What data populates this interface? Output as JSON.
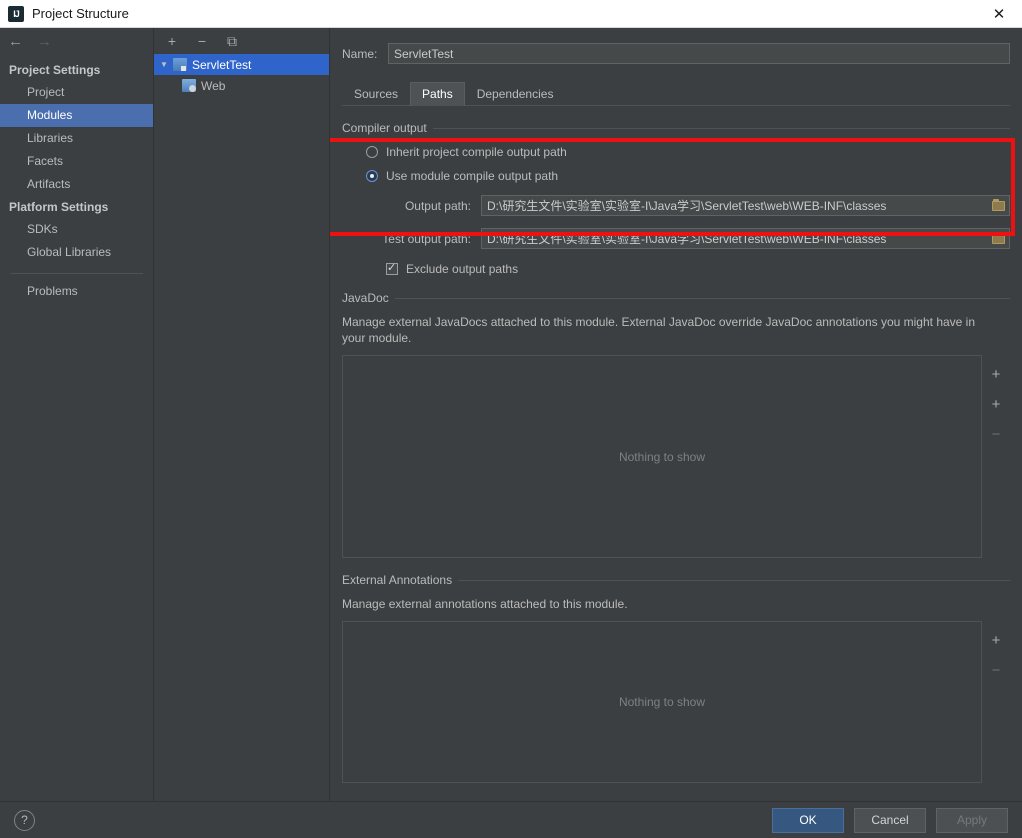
{
  "window": {
    "title": "Project Structure",
    "app_icon": "intellij-idea-icon",
    "close_label": "✕"
  },
  "nav": {
    "back": "←",
    "forward": "→"
  },
  "sidebar": {
    "groups": [
      {
        "title": "Project Settings",
        "items": [
          {
            "label": "Project",
            "selected": false
          },
          {
            "label": "Modules",
            "selected": true
          },
          {
            "label": "Libraries",
            "selected": false
          },
          {
            "label": "Facets",
            "selected": false
          },
          {
            "label": "Artifacts",
            "selected": false
          }
        ]
      },
      {
        "title": "Platform Settings",
        "items": [
          {
            "label": "SDKs",
            "selected": false
          },
          {
            "label": "Global Libraries",
            "selected": false
          }
        ]
      }
    ],
    "problems_label": "Problems"
  },
  "tree": {
    "toolbar": [
      {
        "name": "add-module-button",
        "glyph": "+"
      },
      {
        "name": "remove-module-button",
        "glyph": "−"
      },
      {
        "name": "copy-module-button",
        "glyph": "⧉"
      }
    ],
    "nodes": [
      {
        "label": "ServletTest",
        "icon": "module-icon",
        "selected": true,
        "expanded": true
      },
      {
        "label": "Web",
        "icon": "web-facet-icon",
        "selected": false
      }
    ]
  },
  "detail": {
    "name_label": "Name:",
    "name_value": "ServletTest",
    "tabs": [
      {
        "label": "Sources",
        "active": false
      },
      {
        "label": "Paths",
        "active": true
      },
      {
        "label": "Dependencies",
        "active": false
      }
    ],
    "compiler_output": {
      "section_title": "Compiler output",
      "inherit_option": "Inherit project compile output path",
      "module_option": "Use module compile output path",
      "selected_option": "Use module compile output path",
      "output_path_label": "Output path:",
      "output_path_value": "D:\\研究生文件\\实验室\\实验室-I\\Java学习\\ServletTest\\web\\WEB-INF\\classes",
      "test_output_path_label": "Test output path:",
      "test_output_path_value": "D:\\研究生文件\\实验室\\实验室-I\\Java学习\\ServletTest\\web\\WEB-INF\\classes",
      "exclude_label": "Exclude output paths",
      "exclude_checked": true,
      "browse_icon": "folder-browse-icon",
      "highlight_color": "#ee1111"
    },
    "javadoc": {
      "section_title": "JavaDoc",
      "description": "Manage external JavaDocs attached to this module. External JavaDoc override JavaDoc annotations you might have in your module.",
      "empty_text": "Nothing to show",
      "buttons": [
        {
          "name": "add-javadoc-button",
          "glyph": "+"
        },
        {
          "name": "add-javadoc-url-button",
          "glyph": "+"
        },
        {
          "name": "remove-javadoc-button",
          "glyph": "−"
        }
      ]
    },
    "external_annotations": {
      "section_title": "External Annotations",
      "description": "Manage external annotations attached to this module.",
      "empty_text": "Nothing to show",
      "buttons": [
        {
          "name": "add-annotation-button",
          "glyph": "+"
        },
        {
          "name": "remove-annotation-button",
          "glyph": "−"
        }
      ]
    }
  },
  "footer": {
    "help_glyph": "?",
    "ok_label": "OK",
    "cancel_label": "Cancel",
    "apply_label": "Apply"
  },
  "colors": {
    "background": "#3c3f41",
    "selection_blue": "#2f65ca",
    "sidebar_selection": "#4b6eaf",
    "primary_button": "#365880",
    "highlight_red": "#ee1111"
  }
}
